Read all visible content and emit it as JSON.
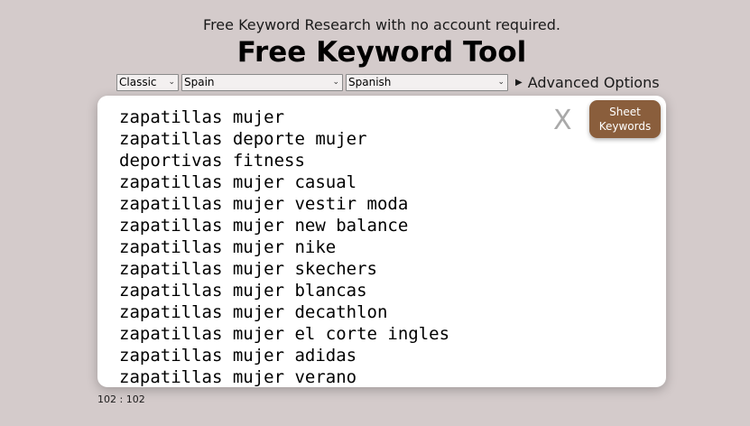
{
  "header": {
    "subtitle": "Free Keyword Research with no account required.",
    "title": "Free Keyword Tool"
  },
  "controls": {
    "mode": "Classic",
    "country": "Spain",
    "language": "Spanish",
    "advanced_label": "Advanced Options"
  },
  "panel": {
    "clear_label": "X",
    "sheet_button": "Sheet\nKeywords",
    "keywords": [
      "zapatillas mujer",
      "zapatillas deporte mujer",
      "deportivas fitness",
      "zapatillas mujer casual",
      "zapatillas mujer vestir moda",
      "zapatillas mujer new balance",
      "zapatillas mujer nike",
      "zapatillas mujer skechers",
      "zapatillas mujer blancas",
      "zapatillas mujer decathlon",
      "zapatillas mujer el corte ingles",
      "zapatillas mujer adidas",
      "zapatillas mujer verano"
    ]
  },
  "counter": "102 : 102",
  "colors": {
    "background": "#d4cbcb",
    "button": "#8a5e3c",
    "clear": "#a9a9a9"
  }
}
